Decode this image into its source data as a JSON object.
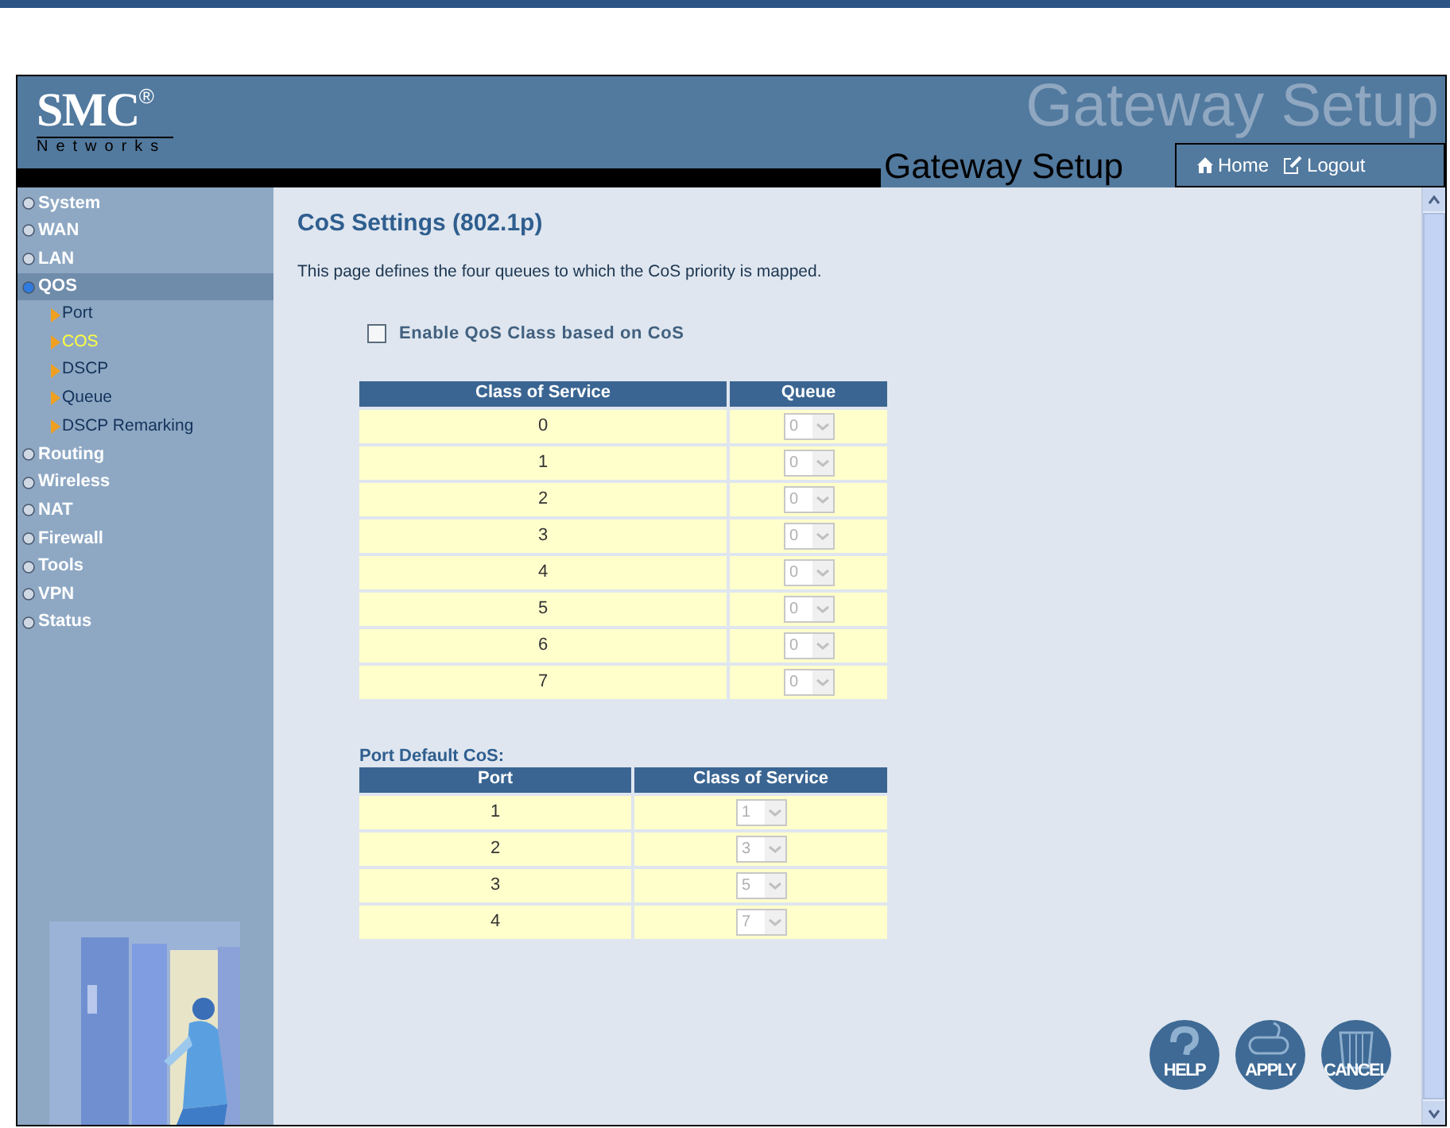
{
  "header": {
    "logo": "SMC",
    "logo_mark": "®",
    "logo_subtitle": "Networks",
    "watermark": "Gateway Setup",
    "title": "Gateway Setup",
    "links": [
      "Home",
      "Logout"
    ]
  },
  "sidebar": {
    "items": [
      {
        "label": "System",
        "selected": false
      },
      {
        "label": "WAN",
        "selected": false
      },
      {
        "label": "LAN",
        "selected": false
      },
      {
        "label": "QOS",
        "selected": true,
        "children": [
          {
            "label": "Port",
            "selected": false
          },
          {
            "label": "COS",
            "selected": true
          },
          {
            "label": "DSCP",
            "selected": false
          },
          {
            "label": "Queue",
            "selected": false
          },
          {
            "label": "DSCP Remarking",
            "selected": false
          }
        ]
      },
      {
        "label": "Routing",
        "selected": false
      },
      {
        "label": "Wireless",
        "selected": false
      },
      {
        "label": "NAT",
        "selected": false
      },
      {
        "label": "Firewall",
        "selected": false
      },
      {
        "label": "Tools",
        "selected": false
      },
      {
        "label": "VPN",
        "selected": false
      },
      {
        "label": "Status",
        "selected": false
      }
    ]
  },
  "content": {
    "title": "CoS Settings (802.1p)",
    "description": "This page defines the four queues to which the CoS priority is mapped.",
    "enable_checkbox": {
      "label": "Enable QoS Class based on CoS",
      "checked": false
    },
    "cos_table": {
      "columns": [
        "Class of Service",
        "Queue"
      ],
      "rows": [
        {
          "cos": "0",
          "queue": "0",
          "disabled": true
        },
        {
          "cos": "1",
          "queue": "0",
          "disabled": true
        },
        {
          "cos": "2",
          "queue": "0",
          "disabled": true
        },
        {
          "cos": "3",
          "queue": "0",
          "disabled": true
        },
        {
          "cos": "4",
          "queue": "0",
          "disabled": true
        },
        {
          "cos": "5",
          "queue": "0",
          "disabled": true
        },
        {
          "cos": "6",
          "queue": "0",
          "disabled": true
        },
        {
          "cos": "7",
          "queue": "0",
          "disabled": true
        }
      ]
    },
    "port_table": {
      "caption": "Port Default CoS:",
      "columns": [
        "Port",
        "Class of Service"
      ],
      "rows": [
        {
          "port": "1",
          "cos": "1",
          "disabled": true
        },
        {
          "port": "2",
          "cos": "3",
          "disabled": true
        },
        {
          "port": "3",
          "cos": "5",
          "disabled": true
        },
        {
          "port": "4",
          "cos": "7",
          "disabled": true
        }
      ]
    },
    "buttons": [
      {
        "kind": "help",
        "label": "HELP"
      },
      {
        "kind": "apply",
        "label": "APPLY"
      },
      {
        "kind": "cancel",
        "label": "CANCEL"
      }
    ]
  }
}
